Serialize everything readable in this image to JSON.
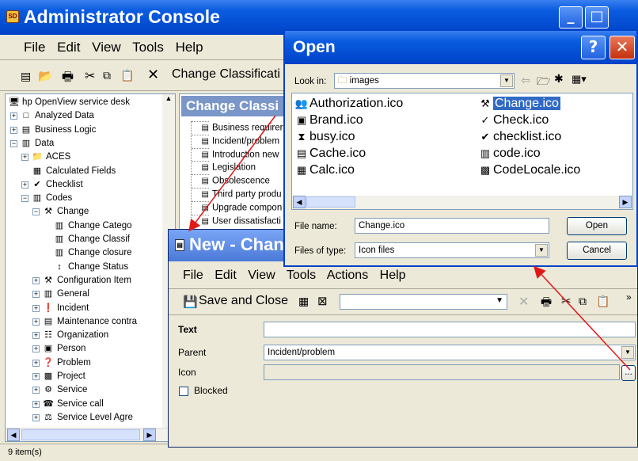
{
  "admin": {
    "title": "Administrator Console",
    "menu": [
      "File",
      "Edit",
      "View",
      "Tools",
      "Help"
    ],
    "toolbar_text": "Change Classificati",
    "content_header": "Change Classi",
    "status": "9 item(s)",
    "tree": [
      {
        "label": "hp OpenView service desk",
        "icon": "🖥",
        "level": 0,
        "exp": ""
      },
      {
        "label": "Analyzed Data",
        "icon": "□",
        "level": 1,
        "exp": "+"
      },
      {
        "label": "Business Logic",
        "icon": "▤",
        "level": 1,
        "exp": "+"
      },
      {
        "label": "Data",
        "icon": "▥",
        "level": 1,
        "exp": "−"
      },
      {
        "label": "ACES",
        "icon": "📁",
        "level": 2,
        "exp": "+"
      },
      {
        "label": "Calculated Fields",
        "icon": "▦",
        "level": 2,
        "exp": ""
      },
      {
        "label": "Checklist",
        "icon": "✔",
        "level": 2,
        "exp": "+"
      },
      {
        "label": "Codes",
        "icon": "▥",
        "level": 2,
        "exp": "−"
      },
      {
        "label": "Change",
        "icon": "⚒",
        "level": 3,
        "exp": "−"
      },
      {
        "label": "Change Catego",
        "icon": "▥",
        "level": 4,
        "exp": ""
      },
      {
        "label": "Change Classif",
        "icon": "▥",
        "level": 4,
        "exp": ""
      },
      {
        "label": "Change closure",
        "icon": "▥",
        "level": 4,
        "exp": ""
      },
      {
        "label": "Change Status",
        "icon": "↕",
        "level": 4,
        "exp": ""
      },
      {
        "label": "Configuration Item",
        "icon": "⚒",
        "level": 3,
        "exp": "+"
      },
      {
        "label": "General",
        "icon": "▥",
        "level": 3,
        "exp": "+"
      },
      {
        "label": "Incident",
        "icon": "❗",
        "level": 3,
        "exp": "+"
      },
      {
        "label": "Maintenance contra",
        "icon": "▤",
        "level": 3,
        "exp": "+"
      },
      {
        "label": "Organization",
        "icon": "☷",
        "level": 3,
        "exp": "+"
      },
      {
        "label": "Person",
        "icon": "▣",
        "level": 3,
        "exp": "+"
      },
      {
        "label": "Problem",
        "icon": "❓",
        "level": 3,
        "exp": "+"
      },
      {
        "label": "Project",
        "icon": "▩",
        "level": 3,
        "exp": "+"
      },
      {
        "label": "Service",
        "icon": "⚙",
        "level": 3,
        "exp": "+"
      },
      {
        "label": "Service call",
        "icon": "☎",
        "level": 3,
        "exp": "+"
      },
      {
        "label": "Service Level Agre",
        "icon": "⚖",
        "level": 3,
        "exp": "+"
      }
    ],
    "list": [
      "Business requirer",
      "Incident/problem",
      "Introduction new",
      "Legislation",
      "Obsolescence",
      "Third party produ",
      "Upgrade compon",
      "User dissatisfacti"
    ]
  },
  "open": {
    "title": "Open",
    "look_in_label": "Look in:",
    "look_in_value": "images",
    "files_col1": [
      {
        "name": "Authorization.ico",
        "icon": "👥"
      },
      {
        "name": "Brand.ico",
        "icon": "▣"
      },
      {
        "name": "busy.ico",
        "icon": "⧗"
      },
      {
        "name": "Cache.ico",
        "icon": "▤"
      },
      {
        "name": "Calc.ico",
        "icon": "▦"
      }
    ],
    "files_col2": [
      {
        "name": "Change.ico",
        "icon": "⚒",
        "selected": true
      },
      {
        "name": "Check.ico",
        "icon": "✓"
      },
      {
        "name": "checklist.ico",
        "icon": "✔"
      },
      {
        "name": "code.ico",
        "icon": "▥"
      },
      {
        "name": "CodeLocale.ico",
        "icon": "▩"
      }
    ],
    "filename_label": "File name:",
    "filename_value": "Change.ico",
    "filetype_label": "Files of type:",
    "filetype_value": "Icon files",
    "open_button": "Open",
    "cancel_button": "Cancel"
  },
  "newchange": {
    "title": "New - Chan",
    "menu": [
      "File",
      "Edit",
      "View",
      "Tools",
      "Actions",
      "Help"
    ],
    "save_close": "Save and Close",
    "text_label": "Text",
    "parent_label": "Parent",
    "parent_value": "Incident/problem",
    "icon_label": "Icon",
    "browse": "...",
    "blocked_label": "Blocked"
  }
}
